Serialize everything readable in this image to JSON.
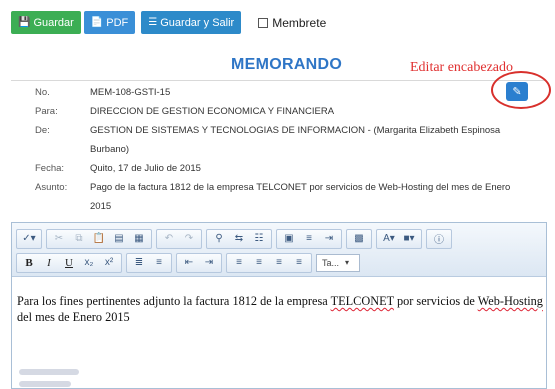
{
  "toolbar": {
    "guardar_label": "Guardar",
    "pdf_label": "PDF",
    "guardar_salir_label": "Guardar y Salir",
    "membrete_label": "Membrete"
  },
  "memo": {
    "title": "MEMORANDO",
    "edit_note": "Editar encabezado"
  },
  "header": {
    "no_label": "No.",
    "no_value": "MEM-108-GSTI-15",
    "para_label": "Para:",
    "para_value": "DIRECCION DE GESTION ECONOMICA Y FINANCIERA",
    "de_label": "De:",
    "de_value_line1": "GESTION DE SISTEMAS Y TECNOLOGIAS DE INFORMACION - (Margarita Elizabeth Espinosa",
    "de_value_line2": "Burbano)",
    "fecha_label": "Fecha:",
    "fecha_value": "Quito, 17 de Julio de 2015",
    "asunto_label": "Asunto:",
    "asunto_value_line1": "Pago de la factura 1812 de la empresa TELCONET por servicios de Web-Hosting del mes de Enero",
    "asunto_value_line2": "2015"
  },
  "editor": {
    "font_combo": "Ta...",
    "body_part1": "Para los fines pertinentes adjunto  la factura 1812 de la empresa ",
    "body_word1": "TELCONET",
    "body_part2": " por servicios de ",
    "body_word2": "Web-Hosting",
    "body_part3": " del mes de Enero 2015"
  },
  "colors": {
    "green_button": "#3cae54",
    "blue_button": "#3a8fd7",
    "title_blue": "#2f76c6",
    "annotation_red": "#e03030"
  }
}
